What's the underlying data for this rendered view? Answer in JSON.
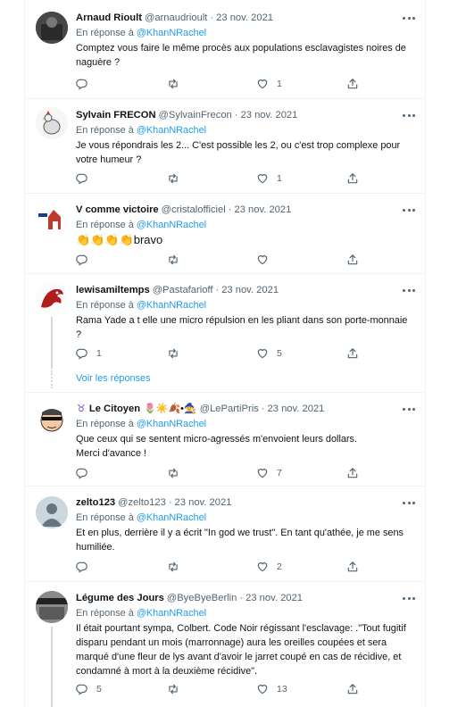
{
  "reply_prefix": "En réponse à",
  "tweets": [
    {
      "name": "Arnaud Rioult",
      "handle": "@arnaudrioult",
      "date": "23 nov. 2021",
      "reply_to": "@KhanNRachel",
      "text": "Comptez vous faire le même procès aux populations esclavagistes noires de naguère ?",
      "replies": "",
      "likes": "1"
    },
    {
      "name": "Sylvain FRECON",
      "handle": "@SylvainFrecon",
      "date": "23 nov. 2021",
      "reply_to": "@KhanNRachel",
      "text": "Je vous répondrais les 2... C'est possible les 2, ou c'est trop complexe pour votre humeur ?",
      "replies": "",
      "likes": "1"
    },
    {
      "name": "V comme victoire",
      "handle": "@cristalofficiel",
      "date": "23 nov. 2021",
      "reply_to": "@KhanNRachel",
      "text": "👏👏👏👏bravo",
      "replies": "",
      "likes": ""
    },
    {
      "name": "lewisamiltemps",
      "handle": "@Pastafarioff",
      "date": "23 nov. 2021",
      "reply_to": "@KhanNRachel",
      "text": "Rama Yade a t elle une micro répulsion en les pliant dans son porte-monnaie ?",
      "replies": "1",
      "likes": "5",
      "show_replies": "Voir les réponses"
    },
    {
      "name": "Le Citoyen",
      "name_prefix": "♉",
      "name_suffix": "🌷☀️🍂•🧙",
      "handle": "@LePartiPris",
      "date": "23 nov. 2021",
      "reply_to": "@KhanNRachel",
      "text": "Que ceux qui se sentent micro-agressés m'envoient leurs dollars.\nMerci d'avance !",
      "replies": "",
      "likes": "7"
    },
    {
      "name": "zelto123",
      "handle": "@zelto123",
      "date": "23 nov. 2021",
      "reply_to": "@KhanNRachel",
      "text": "Et en plus, derrière il y a écrit \"In god we trust\". En tant qu'athée, je me sens humiliée.",
      "replies": "",
      "likes": "2"
    },
    {
      "name": "Légume des Jours",
      "handle": "@ByeByeBerlin",
      "date": "23 nov. 2021",
      "reply_to": "@KhanNRachel",
      "text": "Il était pourtant sympa, Colbert. Code Noir régissant l'esclavage: .\"Tout fugitif disparu pendant un mois (marronnage) aura les oreilles coupées et sera marqué d'une fleur de lys avant d'avoir le jarret coupé en cas de récidive, et condamné à mort à la deuxième récidive\".",
      "replies": "5",
      "likes": "13"
    }
  ],
  "colors": {
    "link": "#1d9bf0",
    "muted": "#536471",
    "border": "#eff3f4",
    "text": "#0f1419"
  }
}
